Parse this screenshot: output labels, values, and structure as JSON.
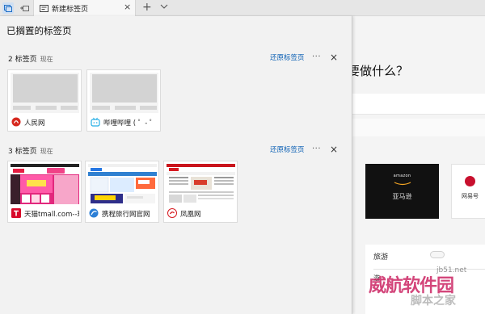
{
  "tabbar": {
    "tab_title": "新建标签页",
    "new_tab_symbol": "+",
    "close_symbol": "×"
  },
  "page": {
    "question_partial": "要做什么？",
    "tiles": [
      {
        "label": "亚马逊",
        "logo_text": "amazon"
      },
      {
        "label": "网易号"
      }
    ],
    "news_title": "旅游",
    "news_item": "游"
  },
  "panel": {
    "title": "已搁置的标签页",
    "groups": [
      {
        "count_label": "2 标签页",
        "time": "现在",
        "restore_label": "还原标签页",
        "more": "···",
        "close": "×",
        "cards": [
          {
            "label": "人民网",
            "icon": "people-daily-icon"
          },
          {
            "label": "哔哩哔哩 ( ゜- ゜",
            "icon": "bilibili-icon"
          }
        ]
      },
      {
        "count_label": "3 标签页",
        "time": "现在",
        "restore_label": "还原标签页",
        "more": "···",
        "close": "×",
        "cards": [
          {
            "label": "天猫tmall.com--理想生活上天猫",
            "icon": "tmall-icon"
          },
          {
            "label": "携程旅行网官网",
            "icon": "ctrip-icon"
          },
          {
            "label": "凤凰网",
            "icon": "ifeng-icon"
          }
        ]
      }
    ]
  },
  "watermark": {
    "text": "威航软件园",
    "sub": "jb51.net",
    "sub2": "脚本之家"
  },
  "colors": {
    "accent": "#0a5fb4",
    "panel_bg": "#f2f2f2",
    "tab_active": "#f7f7f7"
  }
}
